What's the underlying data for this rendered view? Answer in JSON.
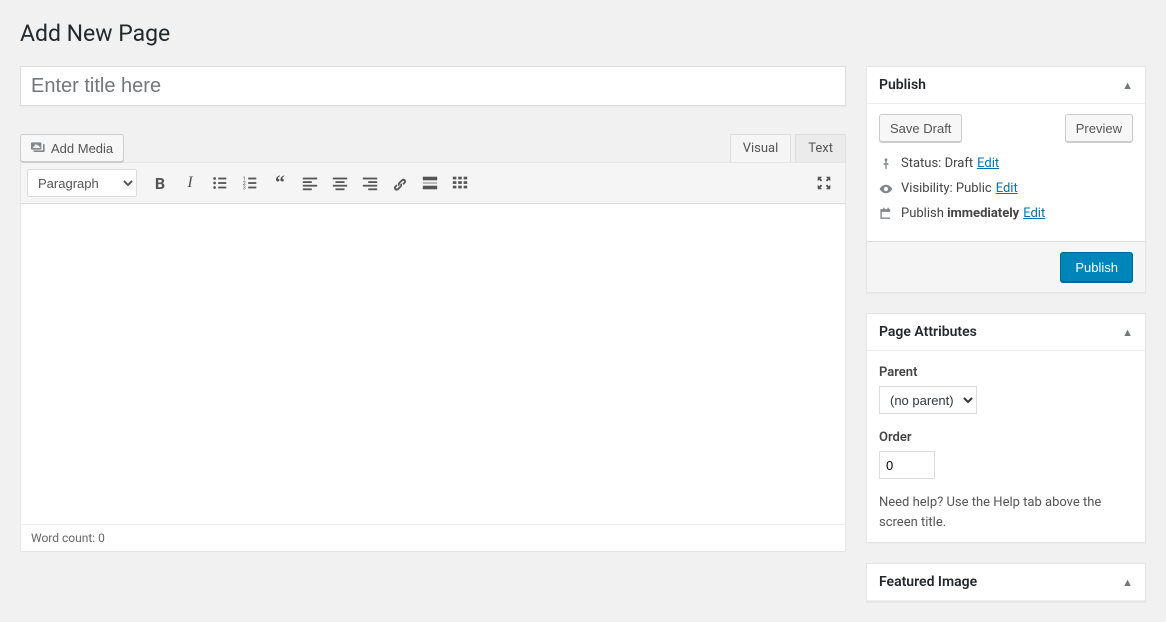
{
  "page_title": "Add New Page",
  "title_placeholder": "Enter title here",
  "add_media_label": "Add Media",
  "editor_tabs": {
    "visual": "Visual",
    "text": "Text"
  },
  "format_selected": "Paragraph",
  "wordcount_label": "Word count: 0",
  "publish_box": {
    "title": "Publish",
    "save_draft": "Save Draft",
    "preview": "Preview",
    "status_label": "Status:",
    "status_value": "Draft",
    "visibility_label": "Visibility:",
    "visibility_value": "Public",
    "schedule_label": "Publish",
    "schedule_value": "immediately",
    "edit_label": "Edit",
    "publish_button": "Publish"
  },
  "attributes_box": {
    "title": "Page Attributes",
    "parent_label": "Parent",
    "parent_selected": "(no parent)",
    "order_label": "Order",
    "order_value": "0",
    "help_text": "Need help? Use the Help tab above the screen title."
  },
  "featured_box": {
    "title": "Featured Image"
  }
}
